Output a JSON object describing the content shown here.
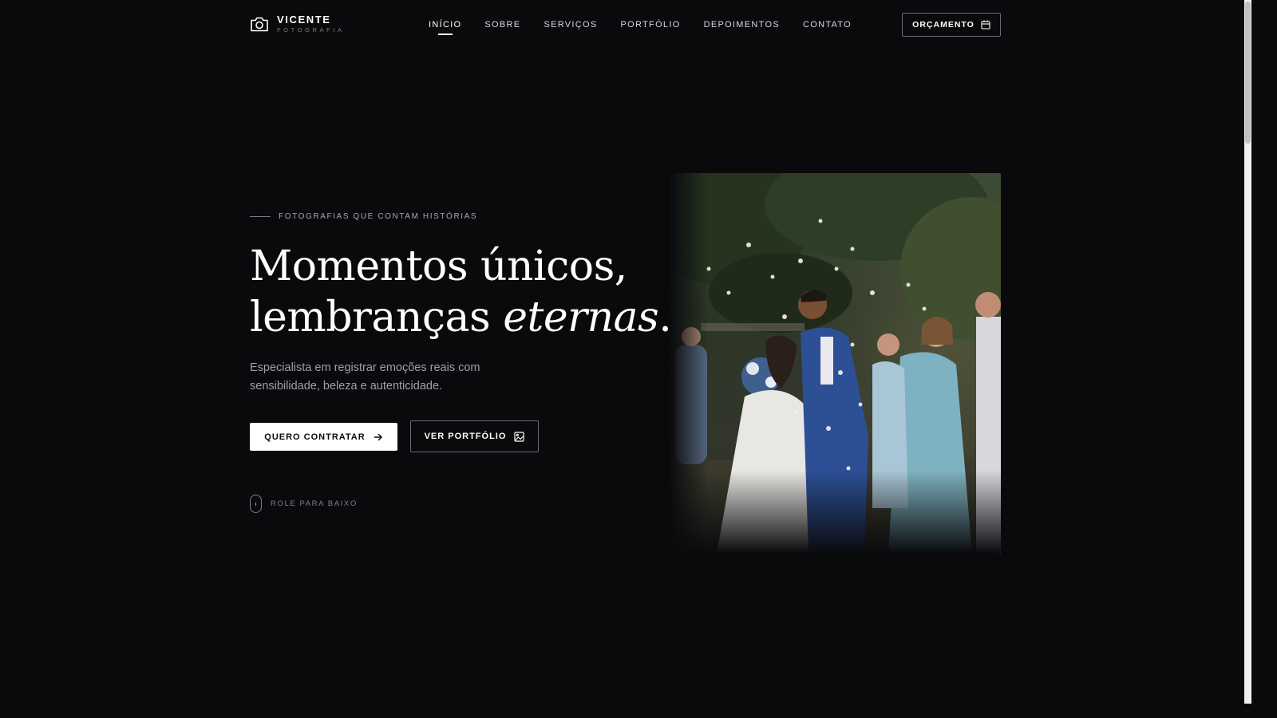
{
  "brand": {
    "name": "VICENTE",
    "subtitle": "FOTOGRAFIA",
    "icon": "camera-icon"
  },
  "nav": {
    "items": [
      {
        "label": "INÍCIO",
        "active": true
      },
      {
        "label": "SOBRE",
        "active": false
      },
      {
        "label": "SERVIÇOS",
        "active": false
      },
      {
        "label": "PORTFÓLIO",
        "active": false
      },
      {
        "label": "DEPOIMENTOS",
        "active": false
      },
      {
        "label": "CONTATO",
        "active": false
      }
    ],
    "cta": {
      "label": "ORÇAMENTO",
      "icon": "calendar-icon"
    }
  },
  "hero": {
    "eyebrow": "FOTOGRAFIAS QUE CONTAM HISTÓRIAS",
    "headline": {
      "line1": "Momentos únicos,",
      "line2_plain": "lembranças ",
      "line2_italic": "eternas",
      "line2_end": "."
    },
    "lead": "Especialista em registrar emoções reais com sensibilidade, beleza e autenticidade.",
    "primary_button": {
      "label": "QUERO CONTRATAR",
      "icon": "arrow-right-icon"
    },
    "secondary_button": {
      "label": "VER PORTFÓLIO",
      "icon": "image-icon"
    },
    "scroll_hint": {
      "label": "ROLE PARA BAIXO",
      "icon": "mouse-icon"
    },
    "photo": {
      "subject": "wedding-couple-kiss-photo"
    }
  },
  "colors": {
    "background": "#0a0a0d",
    "text": "#ffffff",
    "muted": "#9fa0a8",
    "border": "#6a6b72"
  }
}
